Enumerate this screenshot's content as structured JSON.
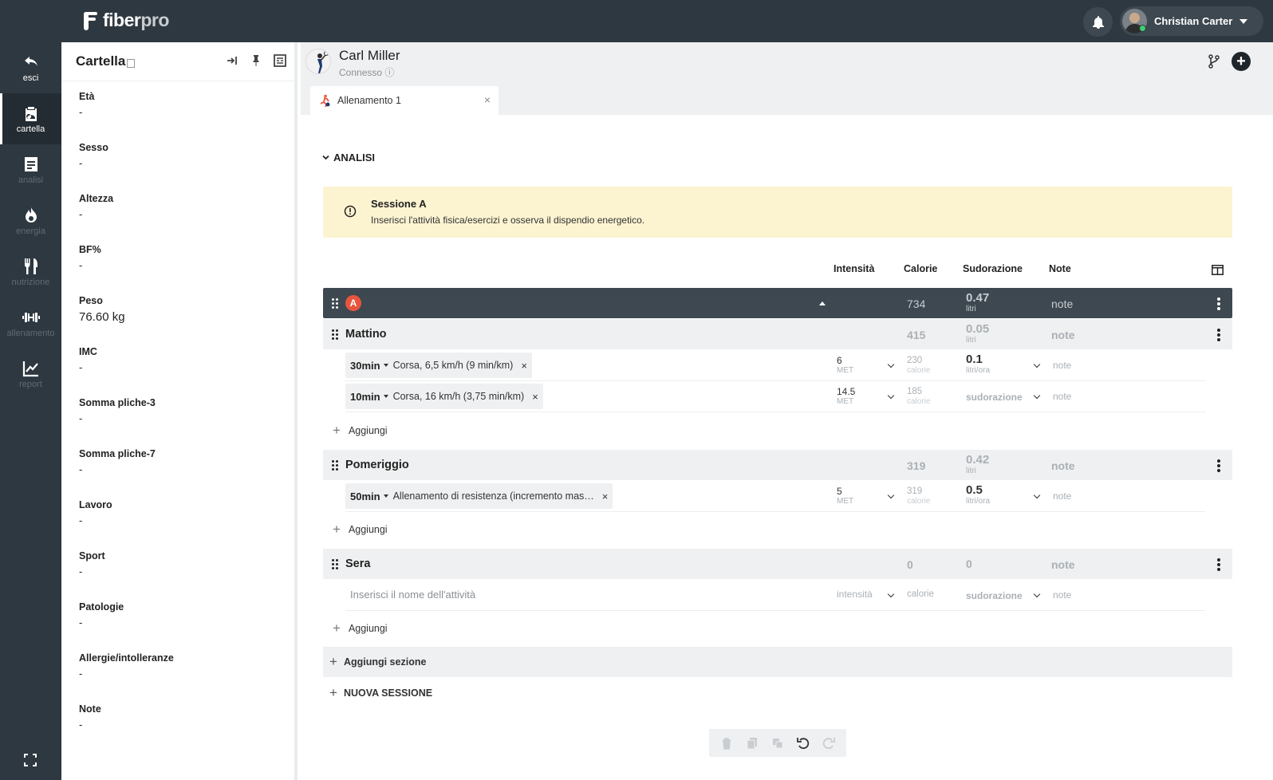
{
  "topbar": {
    "logo_main": "fiber",
    "logo_accent": "pro",
    "user_name": "Christian Carter",
    "icons": [
      "bell-icon",
      "avatar",
      "chevron-down-icon"
    ]
  },
  "nav": {
    "items": [
      {
        "label": "esci",
        "icon": "exit-icon"
      },
      {
        "label": "cartella",
        "icon": "clipboard-icon"
      },
      {
        "label": "analisi",
        "icon": "document-icon"
      },
      {
        "label": "energia",
        "icon": "flame-icon"
      },
      {
        "label": "nutrizione",
        "icon": "fork-knife-icon"
      },
      {
        "label": "allenamento",
        "icon": "dumbbell-icon"
      },
      {
        "label": "report",
        "icon": "chart-icon"
      }
    ]
  },
  "panel": {
    "title": "Cartella",
    "fields": [
      {
        "label": "Età",
        "value": "-"
      },
      {
        "label": "Sesso",
        "value": "-"
      },
      {
        "label": "Altezza",
        "value": "-"
      },
      {
        "label": "BF%",
        "value": "-"
      },
      {
        "label": "Peso",
        "value": "76.60 kg"
      },
      {
        "label": "IMC",
        "value": "-"
      },
      {
        "label": "Somma pliche-3",
        "value": "-"
      },
      {
        "label": "Somma pliche-7",
        "value": "-"
      },
      {
        "label": "Lavoro",
        "value": "-"
      },
      {
        "label": "Sport",
        "value": "-"
      },
      {
        "label": "Patologie",
        "value": "-"
      },
      {
        "label": "Allergie/intolleranze",
        "value": "-"
      },
      {
        "label": "Note",
        "value": "-"
      }
    ]
  },
  "patient": {
    "name": "Carl Miller",
    "status": "Connesso ⓘ"
  },
  "tab": {
    "label": "Allenamento 1",
    "close": "×"
  },
  "analysis": {
    "section_label": "ANALISI",
    "alert_title": "Sessione A",
    "alert_text": "Inserisci l'attività fisica/esercizi e osserva il dispendio energetico.",
    "columns": {
      "intensity": "Intensità",
      "calories": "Calorie",
      "sweat": "Sudorazione",
      "notes": "Note"
    },
    "session": {
      "badge": "A",
      "calories": "734",
      "sweat_value": "0.47",
      "sweat_unit": "litri",
      "note": "note"
    },
    "groups": [
      {
        "name": "Mattino",
        "calories": "415",
        "sweat_value": "0.05",
        "sweat_unit": "litri",
        "note": "note",
        "exercises": [
          {
            "duration": "30min",
            "name": "Corsa, 6,5 km/h (9 min/km)",
            "met": "6",
            "met_unit": "MET",
            "calories": "230",
            "cal_unit": "calorie",
            "sweat_value": "0.1",
            "sweat_unit": "litri/ora",
            "note": "note"
          },
          {
            "duration": "10min",
            "name": "Corsa, 16 km/h (3,75 min/km)",
            "met": "14.5",
            "met_unit": "MET",
            "calories": "185",
            "cal_unit": "calorie",
            "sweat_placeholder": "sudorazione",
            "note": "note"
          }
        ],
        "add_label": "Aggiungi"
      },
      {
        "name": "Pomeriggio",
        "calories": "319",
        "sweat_value": "0.42",
        "sweat_unit": "litri",
        "note": "note",
        "exercises": [
          {
            "duration": "50min",
            "name": "Allenamento di resistenza (incremento mas…",
            "met": "5",
            "met_unit": "MET",
            "calories": "319",
            "cal_unit": "calorie",
            "sweat_value": "0.5",
            "sweat_unit": "litri/ora",
            "note": "note"
          }
        ],
        "add_label": "Aggiungi"
      },
      {
        "name": "Sera",
        "calories": "0",
        "sweat_value": "0",
        "note": "note",
        "empty_row": {
          "activity_placeholder": "Inserisci il nome dell'attività",
          "intensity_placeholder": "intensità",
          "calories_placeholder": "calorie",
          "sweat_placeholder": "sudorazione",
          "note": "note"
        },
        "add_label": "Aggiungi"
      }
    ],
    "add_section": "Aggiungi sezione",
    "new_session": "NUOVA SESSIONE"
  },
  "toolbar_icons": [
    "trash-icon",
    "copy-icon",
    "duplicate-icon",
    "undo-icon",
    "redo-icon"
  ]
}
